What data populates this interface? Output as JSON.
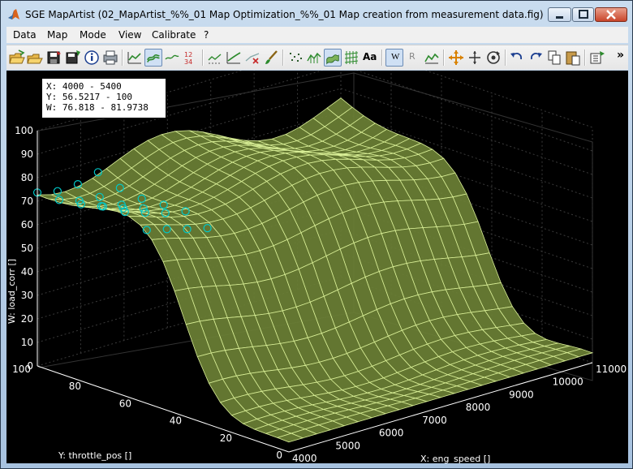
{
  "window": {
    "title": "SGE MapArtist (02_MapArtist_%%_01 Map Optimization_%%_01 Map creation from measurement data.fig)"
  },
  "menubar": {
    "items": [
      "Data",
      "Map",
      "Mode",
      "View",
      "Calibrate",
      "?"
    ]
  },
  "toolbar": {
    "buttons": [
      "open-folder-icon",
      "open-file-icon",
      "save-icon",
      "save-as-icon",
      "info-icon",
      "print-icon",
      "line-plot-icon",
      "surface-plot-icon",
      "contour-plot-icon",
      "table-view-icon",
      "edit-curve-icon",
      "smooth-curve-icon",
      "clear-curve-icon",
      "brush-icon",
      "scatter-points-icon",
      "wireframe-icon",
      "surface-icon",
      "mesh-icon",
      "font-icon",
      "w-axis-button",
      "r-axis-button",
      "map-check-icon",
      "select-move-icon",
      "expand-icon",
      "rotate-icon",
      "undo-icon",
      "redo-icon",
      "copy-icon",
      "paste-icon",
      "export-icon",
      "overflow-chevron-icon"
    ],
    "font_label": "Aa",
    "w_label": "W",
    "r_label": "R",
    "table_top": "12",
    "table_bottom": "34",
    "overflow": "»"
  },
  "range_box": {
    "x": "X: 4000 - 5400",
    "y": "Y: 56.5217 - 100",
    "w": "W: 76.818 - 81.9738"
  },
  "chart_data": {
    "type": "surface",
    "xlabel": "X: eng_speed []",
    "ylabel": "Y: throttle_pos []",
    "zlabel": "W: load_corr []",
    "x_ticks": [
      "4000",
      "5000",
      "6000",
      "7000",
      "8000",
      "9000",
      "10000",
      "11000"
    ],
    "y_ticks": [
      "0",
      "20",
      "40",
      "60",
      "80",
      "100"
    ],
    "z_ticks": [
      "0",
      "10",
      "20",
      "30",
      "40",
      "50",
      "60",
      "70",
      "80",
      "90",
      "100"
    ],
    "xlim": [
      4000,
      11000
    ],
    "ylim": [
      0,
      100
    ],
    "zlim": [
      0,
      100
    ],
    "grid": true,
    "surface_color": "#6b8035",
    "mesh_color": "#d8ee96",
    "highlight_color": "#00c8c8",
    "selected_range": {
      "x": [
        4000,
        5400
      ],
      "y": [
        56.5217,
        100
      ],
      "w": [
        76.818,
        81.9738
      ]
    }
  }
}
